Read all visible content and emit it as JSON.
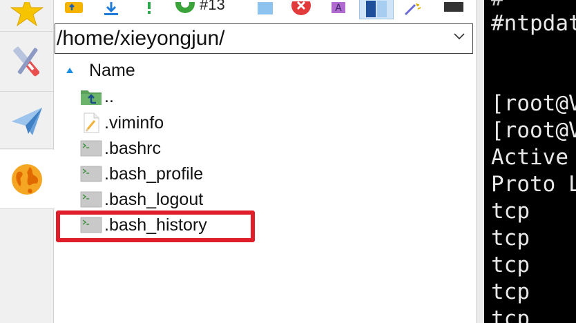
{
  "toolbar": {
    "partial_text": "#13"
  },
  "path_bar": {
    "value": "/home/xieyongjun/"
  },
  "file_list": {
    "column_name": "Name",
    "files": [
      {
        "name": "..",
        "icon": "folder-up-icon"
      },
      {
        "name": ".viminfo",
        "icon": "text-file-icon"
      },
      {
        "name": ".bashrc",
        "icon": "shell-script-icon"
      },
      {
        "name": ".bash_profile",
        "icon": "shell-script-icon"
      },
      {
        "name": ".bash_logout",
        "icon": "shell-script-icon"
      },
      {
        "name": ".bash_history",
        "icon": "shell-script-icon"
      }
    ]
  },
  "terminal": {
    "lines": [
      "#ntpdat",
      "[root@V",
      "[root@V",
      "Active",
      "Proto L",
      "tcp",
      "tcp",
      "tcp",
      "tcp",
      "tcp"
    ]
  },
  "colors": {
    "highlight": "#e01e2a",
    "folder_green": "#5aa05a",
    "accent_blue": "#1e7bd6"
  }
}
